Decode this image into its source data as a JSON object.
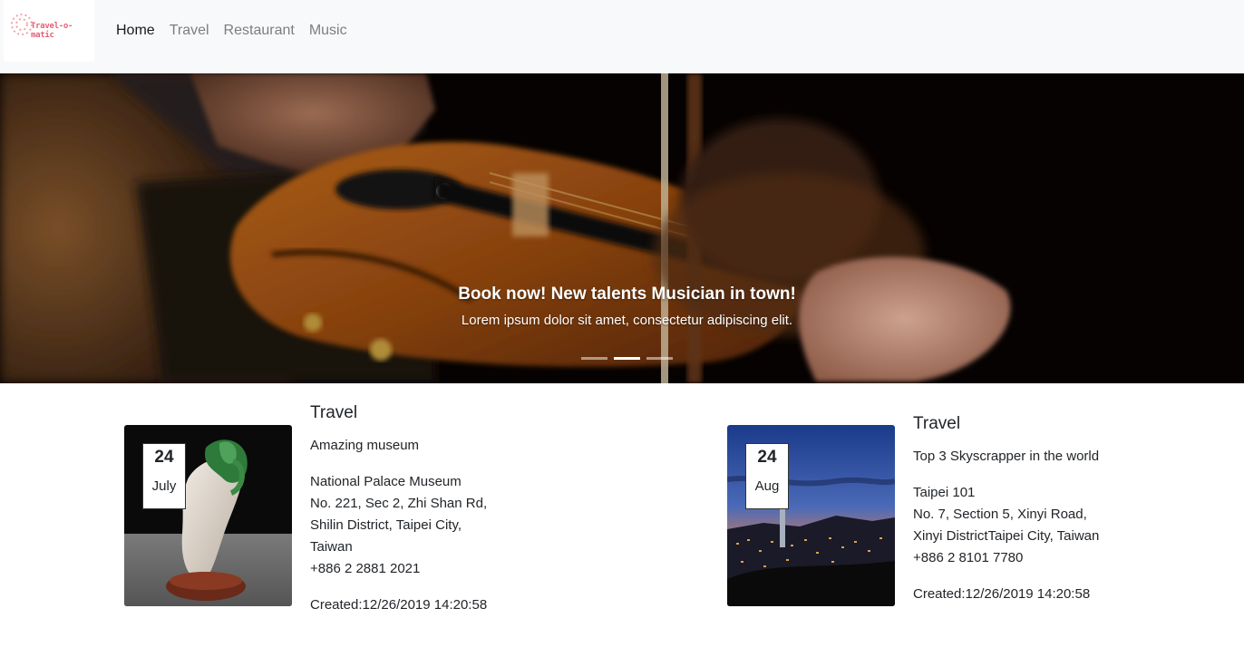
{
  "navbar": {
    "logo_text": "Travel-o-matic",
    "links": [
      {
        "label": "Home",
        "active": true
      },
      {
        "label": "Travel",
        "active": false
      },
      {
        "label": "Restaurant",
        "active": false
      },
      {
        "label": "Music",
        "active": false
      }
    ]
  },
  "carousel": {
    "caption_title": "Book now! New talents Musician in town!",
    "caption_text": "Lorem ipsum dolor sit amet, consectetur adipiscing elit.",
    "slide_count": 3,
    "active_slide": 2
  },
  "cards": [
    {
      "day": "24",
      "month": "July",
      "title": "Travel",
      "description": "Amazing museum",
      "address_lines": [
        "National Palace Museum",
        "No. 221, Sec 2, Zhi Shan Rd,",
        "Shilin District, Taipei City,",
        "Taiwan",
        "+886 2 2881 2021"
      ],
      "created": "Created:12/26/2019 14:20:58"
    },
    {
      "day": "24",
      "month": "Aug",
      "title": "Travel",
      "description": "Top 3 Skyscrapper in the world",
      "address_lines": [
        "Taipei 101",
        "No. 7, Section 5, Xinyi Road,",
        "Xinyi DistrictTaipei City, Taiwan",
        "+886 2 8101 7780"
      ],
      "created": "Created:12/26/2019 14:20:58"
    }
  ]
}
